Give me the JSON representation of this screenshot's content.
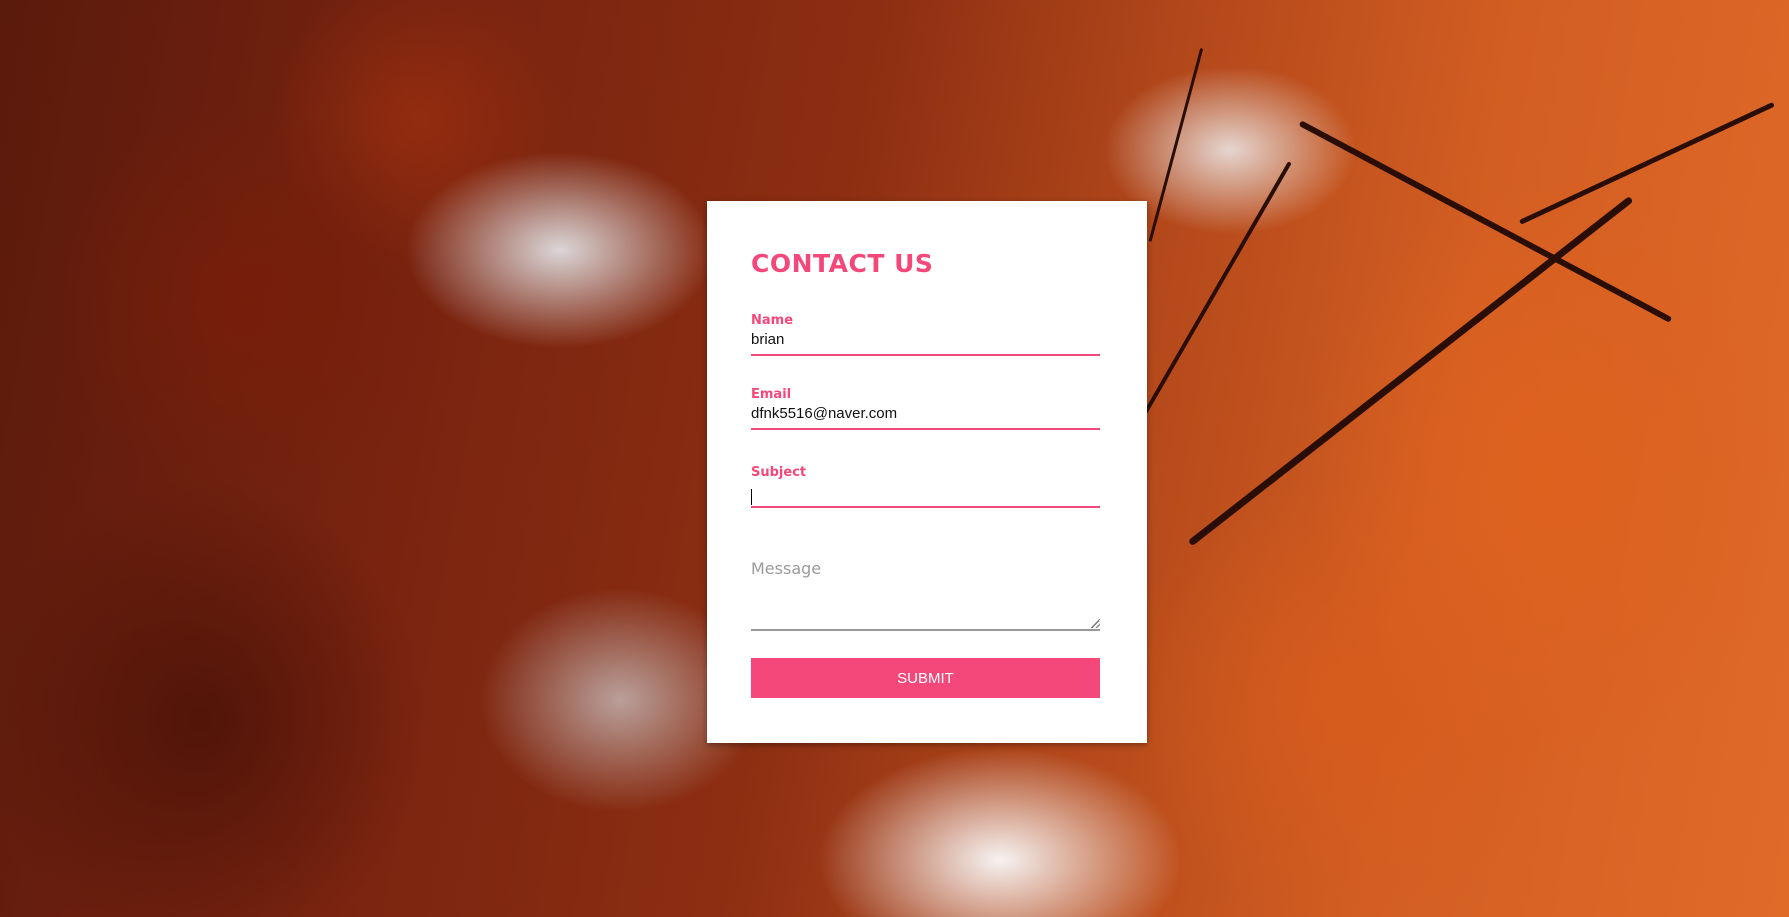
{
  "background": {
    "description_colors": {
      "dark_foliage": "#5a1a0c",
      "orange_foliage": "#e06a28",
      "branch": "#2a0e06"
    }
  },
  "form": {
    "title": "CONTACT US",
    "accent_color": "#f4477a",
    "fields": {
      "name": {
        "label": "Name",
        "value": "brian"
      },
      "email": {
        "label": "Email",
        "value": "dfnk5516@naver.com"
      },
      "subject": {
        "label": "Subject",
        "value": ""
      },
      "message": {
        "placeholder": "Message",
        "value": ""
      }
    },
    "submit_label": "SUBMIT"
  }
}
